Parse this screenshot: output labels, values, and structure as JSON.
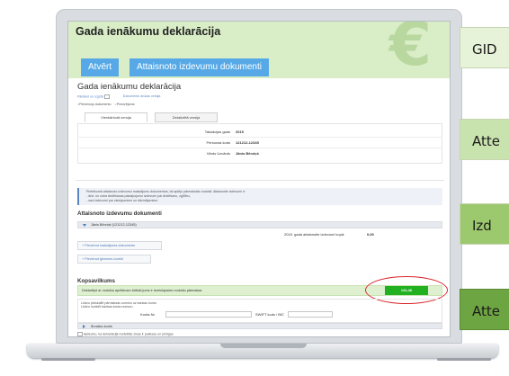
{
  "hero": {
    "title": "Gada ienākumu deklarācija",
    "open_button": "Atvērt",
    "attach_button": "Attaisnoto izdevumu dokumenti"
  },
  "page": {
    "title": "Gada ienākumu deklarācija",
    "toolbar": {
      "print_label": "Pārlūkot un izgūtā",
      "doc_link": "Dokumentu drukas versija"
    },
    "radio_1": "Pievienoju dokumentu",
    "radio_2": "Precizējuma",
    "tab_1": "Vienkāršotā versija",
    "tab_2": "Detalizētā versija",
    "info": [
      {
        "label": "Taksācijas gads",
        "value": "2015"
      },
      {
        "label": "Personas kods",
        "value": "121212-12345"
      },
      {
        "label": "Vārds Uzvārds",
        "value": "Jānis Bērziņš"
      }
    ],
    "note_line_1": "Pieteikumā attaisnoto izdevumu maksājumu dokumentus, lai aptēju pārmaksāto nodokli. Attaisnotie izdevumi ir:",
    "note_line_2": "- ārst. un zoba ārstēšanas pakalpojumu izdevumi par ārstēšanu, zgļītību,",
    "note_line_3": "- savi izdevumi par ziedojumiem un dāvinājumiem.",
    "section_expenses": "Attaisnoto izdevumu dokumenti",
    "person_bar": "Jānis Bērziņš (121212-12345)",
    "total_label": "2015. gada attaisnotie izdevumi kopā:",
    "total_value": "0,00",
    "add_payment_doc": "Pievienot maksājuma dokumentu",
    "add_family_member": "Pievienot ģimenes locekli",
    "summary_title": "Kopsavilkums",
    "summary_text": "Deklarējot ar nodokļu aprēķinam būtiski jums ir izveidojusies nodokļu pārmaksa",
    "summary_amount": "131,46",
    "bank_line_1": "Lūdzu pārskaitīt pārmaksas summu uz bankas kontu",
    "bank_line_2": "Lūdzu norādīt bankas konta numuru",
    "bank_account_label": "Konta Nr.",
    "swift_label": "SWIFT kods / BIC",
    "foreign_account": "Ārvalstu konts",
    "confirm_text": "Apliecinu, ka deklarācijā norādītās ziņas ir patiesas un pilnīgas",
    "footer_print": "Pārlūkot un izgūtā",
    "footer_doc_link": "Dokumentu drukas versija"
  },
  "side_panel": [
    {
      "label": "GID"
    },
    {
      "label": "Atte"
    },
    {
      "label": "Izd"
    },
    {
      "label": "Atte"
    }
  ],
  "colors": {
    "accent_blue": "#56a9e6",
    "hero_green": "#d9edc6",
    "amount_green": "#20b020",
    "highlight_red": "#d9252a"
  }
}
